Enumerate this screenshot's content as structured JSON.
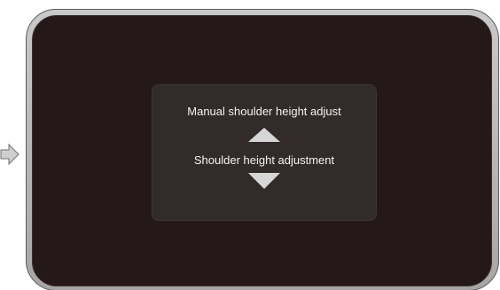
{
  "panel": {
    "title": "Manual shoulder height adjust",
    "adjust_label": "Shoulder height adjustment"
  },
  "icons": {
    "up": "triangle-up-icon",
    "down": "triangle-down-icon",
    "pointer": "pointer-arrow-icon"
  },
  "colors": {
    "screen": "#241918",
    "panel": "#332b2a",
    "bezel": "#b5b5b5",
    "text": "#f2f2f2",
    "arrow": "#d6d6d6"
  }
}
